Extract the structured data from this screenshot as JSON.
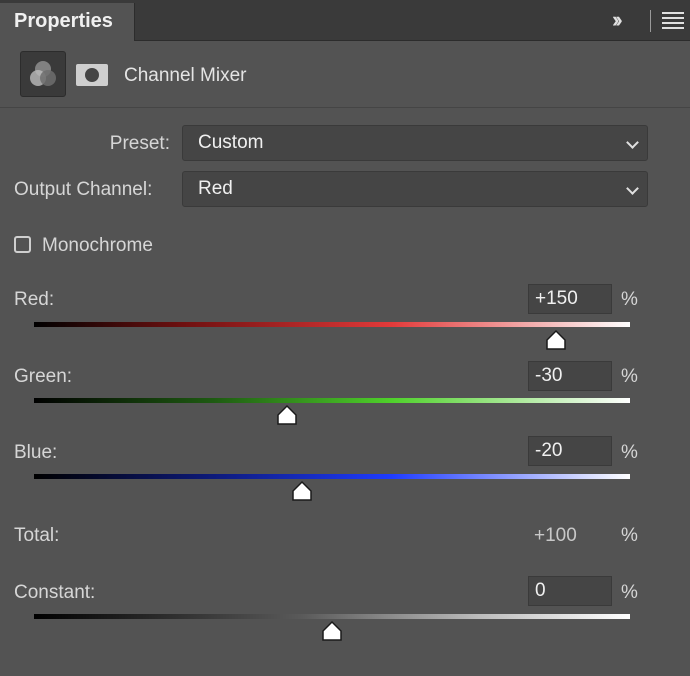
{
  "panel": {
    "tab_title": "Properties",
    "title": "Channel Mixer"
  },
  "icons": {
    "collapse": "double-chevron-right-icon",
    "menu": "hamburger-menu-icon",
    "adjustment": "channel-mixer-icon",
    "mask": "layer-mask-icon"
  },
  "preset": {
    "label": "Preset:",
    "value": "Custom"
  },
  "output_channel": {
    "label": "Output Channel:",
    "value": "Red"
  },
  "monochrome": {
    "label": "Monochrome",
    "checked": false
  },
  "percent_sign": "%",
  "sliders": {
    "red": {
      "label": "Red:",
      "value": "+150",
      "level": 150,
      "min": -200,
      "max": 200
    },
    "green": {
      "label": "Green:",
      "value": "-30",
      "level": -30,
      "min": -200,
      "max": 200
    },
    "blue": {
      "label": "Blue:",
      "value": "-20",
      "level": -20,
      "min": -200,
      "max": 200
    }
  },
  "total": {
    "label": "Total:",
    "value": "+100"
  },
  "constant": {
    "label": "Constant:",
    "value": "0",
    "level": 0,
    "min": -200,
    "max": 200
  }
}
